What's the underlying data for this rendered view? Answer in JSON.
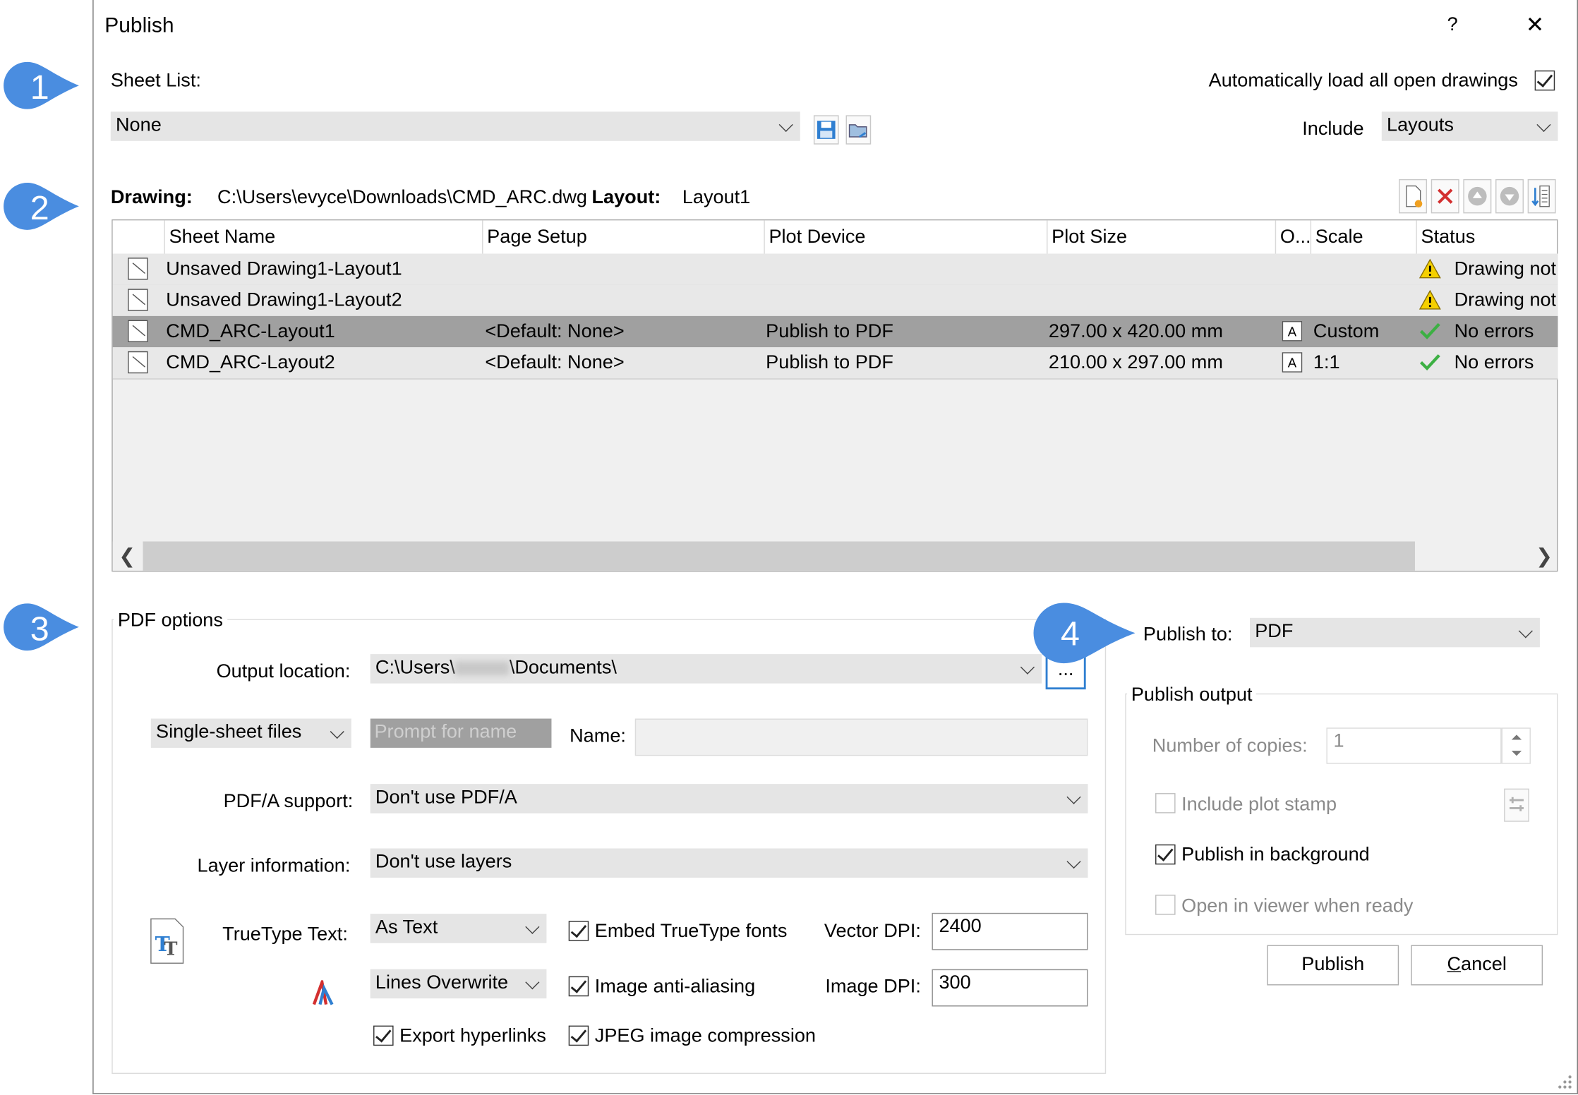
{
  "window": {
    "title": "Publish",
    "help_label": "?",
    "close_label": "✕"
  },
  "callouts": [
    "1",
    "2",
    "3",
    "4"
  ],
  "sheet_list": {
    "label": "Sheet List:",
    "value": "None",
    "auto_load_label": "Automatically load all open drawings",
    "auto_load_checked": true,
    "include_label": "Include",
    "include_value": "Layouts"
  },
  "drawing_info": {
    "drawing_label": "Drawing:",
    "drawing_path": "C:\\Users\\evyce\\Downloads\\CMD_ARC.dwg",
    "layout_label": "Layout:",
    "layout_value": "Layout1"
  },
  "table": {
    "columns": [
      "Sheet Name",
      "Page Setup",
      "Plot Device",
      "Plot Size",
      "O...",
      "Scale",
      "Status"
    ],
    "rows": [
      {
        "name": "Unsaved Drawing1-Layout1",
        "page_setup": "",
        "plot_device": "",
        "plot_size": "",
        "orientation": "",
        "scale": "",
        "status": "Drawing not",
        "status_type": "warning",
        "selected": false
      },
      {
        "name": "Unsaved Drawing1-Layout2",
        "page_setup": "",
        "plot_device": "",
        "plot_size": "",
        "orientation": "",
        "scale": "",
        "status": "Drawing not",
        "status_type": "warning",
        "selected": false
      },
      {
        "name": "CMD_ARC-Layout1",
        "page_setup": "<Default: None>",
        "plot_device": "Publish to PDF",
        "plot_size": "297.00 x 420.00 mm",
        "orientation": "A",
        "scale": "Custom",
        "status": "No errors",
        "status_type": "ok",
        "selected": true
      },
      {
        "name": "CMD_ARC-Layout2",
        "page_setup": "<Default: None>",
        "plot_device": "Publish to PDF",
        "plot_size": "210.00 x 297.00 mm",
        "orientation": "A",
        "scale": "1:1",
        "status": "No errors",
        "status_type": "ok",
        "selected": false
      }
    ]
  },
  "pdf_options": {
    "group_label": "PDF options",
    "output_location_label": "Output location:",
    "output_location_value_start": "C:\\Users\\",
    "output_location_value_end": "\\Documents\\",
    "browse_label": "...",
    "file_mode": "Single-sheet files",
    "prompt_placeholder": "Prompt for name",
    "name_label": "Name:",
    "pdfa_label": "PDF/A support:",
    "pdfa_value": "Don't use PDF/A",
    "layer_label": "Layer information:",
    "layer_value": "Don't use layers",
    "truetype_label": "TrueType Text:",
    "truetype_value": "As Text",
    "lines_value": "Lines Overwrite",
    "embed_fonts_label": "Embed TrueType fonts",
    "antialias_label": "Image anti-aliasing",
    "jpeg_label": "JPEG image compression",
    "hyperlinks_label": "Export hyperlinks",
    "vector_dpi_label": "Vector DPI:",
    "vector_dpi_value": "2400",
    "image_dpi_label": "Image DPI:",
    "image_dpi_value": "300"
  },
  "publish": {
    "publish_to_label": "Publish to:",
    "publish_to_value": "PDF",
    "output_group_label": "Publish output",
    "copies_label": "Number of copies:",
    "copies_value": "1",
    "plot_stamp_label": "Include plot stamp",
    "background_label": "Publish in background",
    "viewer_label": "Open in viewer when ready",
    "publish_button": "Publish",
    "cancel_button": "Cancel"
  },
  "colors": {
    "callout": "#4a8de0",
    "selected_row": "#a0a0a0",
    "ok": "#3cb043",
    "warning": "#e8c000",
    "delete": "#d32f2f"
  }
}
